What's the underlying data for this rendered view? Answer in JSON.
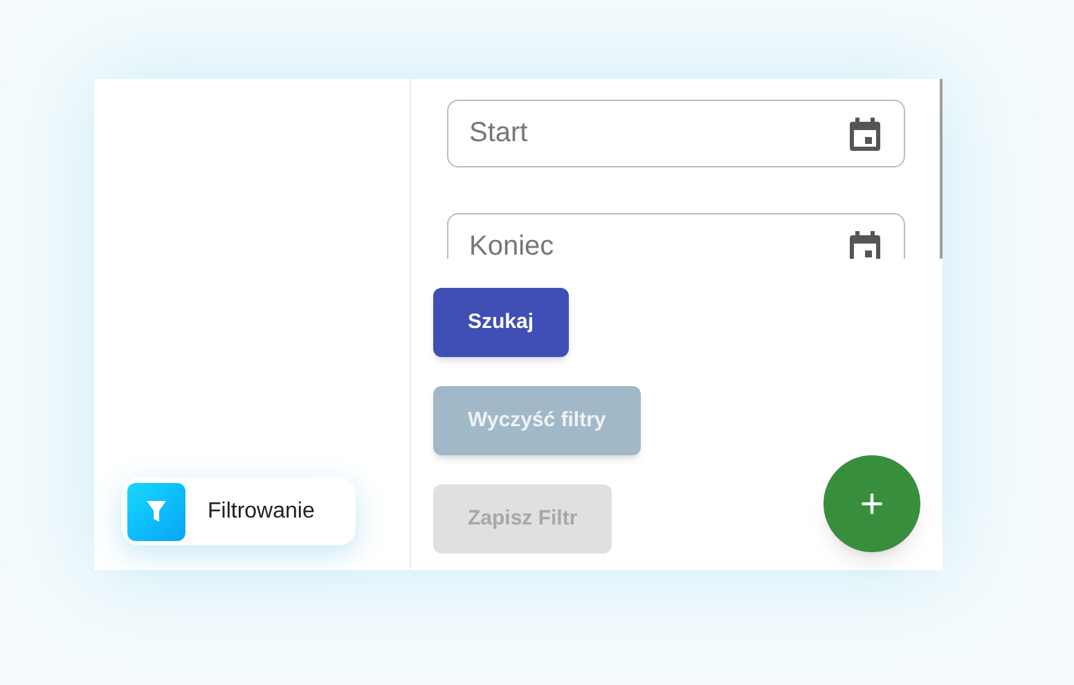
{
  "sidebar": {
    "item": {
      "label": "Filtrowanie",
      "selected": true
    }
  },
  "fields": [
    {
      "placeholder": "Start"
    },
    {
      "placeholder": "Koniec"
    }
  ],
  "buttons": [
    {
      "label": "Szukaj",
      "kind": "primary"
    },
    {
      "label": "Wyczyść filtry",
      "kind": "secondary"
    },
    {
      "label": "Zapisz Filtr",
      "kind": "disabled"
    }
  ],
  "fab": {
    "label": "+"
  }
}
